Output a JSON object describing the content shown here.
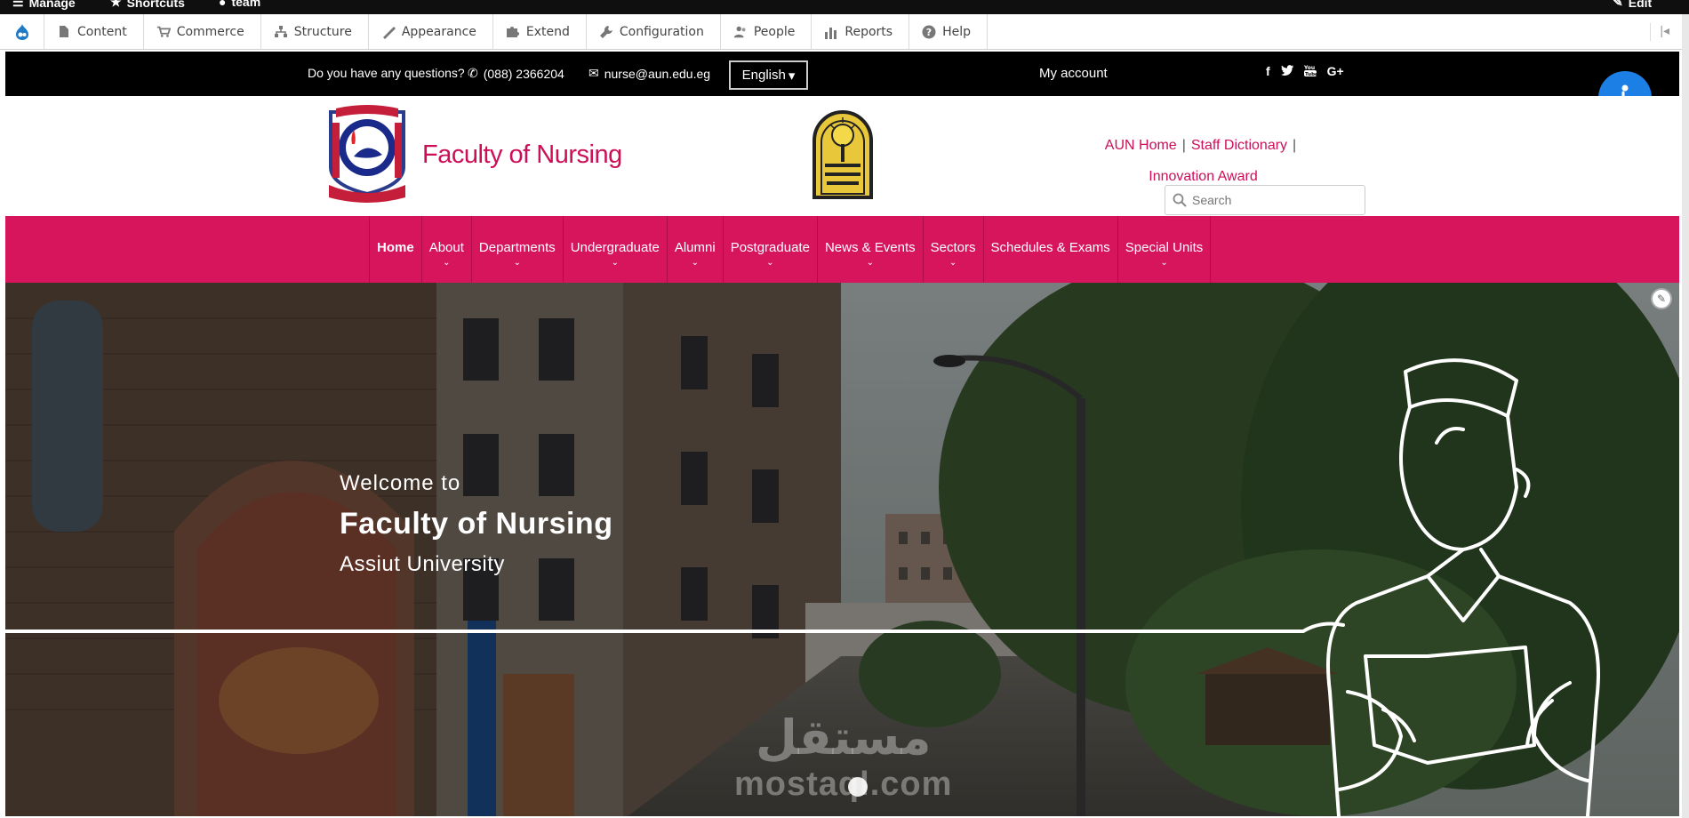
{
  "admin_bar": {
    "manage_label": "Manage",
    "shortcuts_label": "Shortcuts",
    "user_label": "team",
    "edit_label": "Edit"
  },
  "admin_tray": {
    "items": [
      {
        "label": "Content",
        "icon": "file-icon"
      },
      {
        "label": "Commerce",
        "icon": "cart-icon"
      },
      {
        "label": "Structure",
        "icon": "sitemap-icon"
      },
      {
        "label": "Appearance",
        "icon": "brush-icon"
      },
      {
        "label": "Extend",
        "icon": "puzzle-icon"
      },
      {
        "label": "Configuration",
        "icon": "wrench-icon"
      },
      {
        "label": "People",
        "icon": "people-icon"
      },
      {
        "label": "Reports",
        "icon": "bar-chart-icon"
      },
      {
        "label": "Help",
        "icon": "help-icon"
      }
    ]
  },
  "topbar": {
    "question": "Do you have any questions?",
    "phone": "(088) 2366204",
    "email": "nurse@aun.edu.eg",
    "language": "English",
    "my_account": "My account",
    "socials": [
      "f",
      "t",
      "yt",
      "G+"
    ]
  },
  "header": {
    "site_title": "Faculty of Nursing",
    "link_aun_home": "AUN Home",
    "link_staff_dictionary": "Staff Dictionary",
    "link_innovation_award": "Innovation Award",
    "search_placeholder": "Search"
  },
  "nav": {
    "items": [
      {
        "label": "Home",
        "active": true,
        "dropdown": false
      },
      {
        "label": "About",
        "dropdown": true
      },
      {
        "label": "Departments",
        "dropdown": true
      },
      {
        "label": "Undergraduate",
        "dropdown": true
      },
      {
        "label": "Alumni",
        "dropdown": true
      },
      {
        "label": "Postgraduate",
        "dropdown": true
      },
      {
        "label": "News & Events",
        "dropdown": true
      },
      {
        "label": "Sectors",
        "dropdown": true
      },
      {
        "label": "Schedules & Exams",
        "dropdown": false
      },
      {
        "label": "Special Units",
        "dropdown": true
      }
    ]
  },
  "hero": {
    "welcome": "Welcome to",
    "title": "Faculty of Nursing",
    "subtitle": "Assiut University",
    "watermark_ar": "مستقل",
    "watermark_en": "mostaql.com"
  },
  "colors": {
    "brand": "#d6155d",
    "brand_text": "#cc0f57",
    "topbar_bg": "#000000",
    "a11y": "#1c7fe6"
  }
}
